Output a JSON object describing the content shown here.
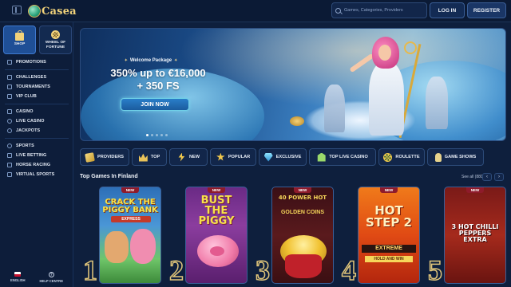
{
  "header": {
    "logo_text": "Casea",
    "search_placeholder": "Games, Categories, Providers",
    "login_label": "LOG IN",
    "register_label": "REGISTER"
  },
  "sidebar": {
    "tiles": [
      {
        "label": "SHOP",
        "icon": "shop-icon"
      },
      {
        "label": "WHEEL OF FORTUNE",
        "icon": "wheel-icon"
      }
    ],
    "groups": [
      [
        {
          "label": "PROMOTIONS"
        }
      ],
      [
        {
          "label": "CHALLENGES"
        },
        {
          "label": "TOURNAMENTS"
        },
        {
          "label": "VIP CLUB"
        }
      ],
      [
        {
          "label": "CASINO"
        },
        {
          "label": "LIVE CASINO"
        },
        {
          "label": "JACKPOTS"
        }
      ],
      [
        {
          "label": "SPORTS"
        },
        {
          "label": "LIVE BETTING"
        },
        {
          "label": "HORSE RACING"
        },
        {
          "label": "VIRTUAL SPORTS"
        }
      ]
    ],
    "bottom": {
      "language_label": "ENGLISH",
      "help_label": "HELP CENTRE"
    }
  },
  "banner": {
    "tag": "Welcome Package",
    "line1": "350% up to €16,000",
    "line2": "+ 350 FS",
    "cta": "JOIN NOW",
    "slides_total": 5,
    "active_slide": 1
  },
  "categories": [
    {
      "label": "PROVIDERS",
      "icon": "providers-icon"
    },
    {
      "label": "TOP",
      "icon": "crown-icon"
    },
    {
      "label": "NEW",
      "icon": "lightning-icon"
    },
    {
      "label": "POPULAR",
      "icon": "star-icon"
    },
    {
      "label": "EXCLUSIVE",
      "icon": "diamond-icon"
    },
    {
      "label": "TOP LIVE CASINO",
      "icon": "live-casino-icon"
    },
    {
      "label": "ROULETTE",
      "icon": "roulette-icon"
    },
    {
      "label": "GAME SHOWS",
      "icon": "microphone-icon"
    }
  ],
  "section": {
    "title": "Top Games In Finland",
    "see_all": "See all (880)",
    "prev_icon": "‹",
    "next_icon": "›"
  },
  "games": [
    {
      "rank": "1",
      "badge": "NEW",
      "title": "CRACK THE PIGGY BANK",
      "subtitle": "EXPRESS"
    },
    {
      "rank": "2",
      "badge": "NEW",
      "title": "BUST THE PIGGY"
    },
    {
      "rank": "3",
      "badge": "NEW",
      "title": "40 POWER HOT",
      "subtitle": "GOLDEN COINS"
    },
    {
      "rank": "4",
      "badge": "NEW",
      "title": "HOT STEP 2",
      "subtitle": "EXTREME",
      "tagline": "HOLD AND WIN"
    },
    {
      "rank": "5",
      "badge": "NEW",
      "title": "3 HOT CHILLI PEPPERS EXTRA"
    }
  ]
}
